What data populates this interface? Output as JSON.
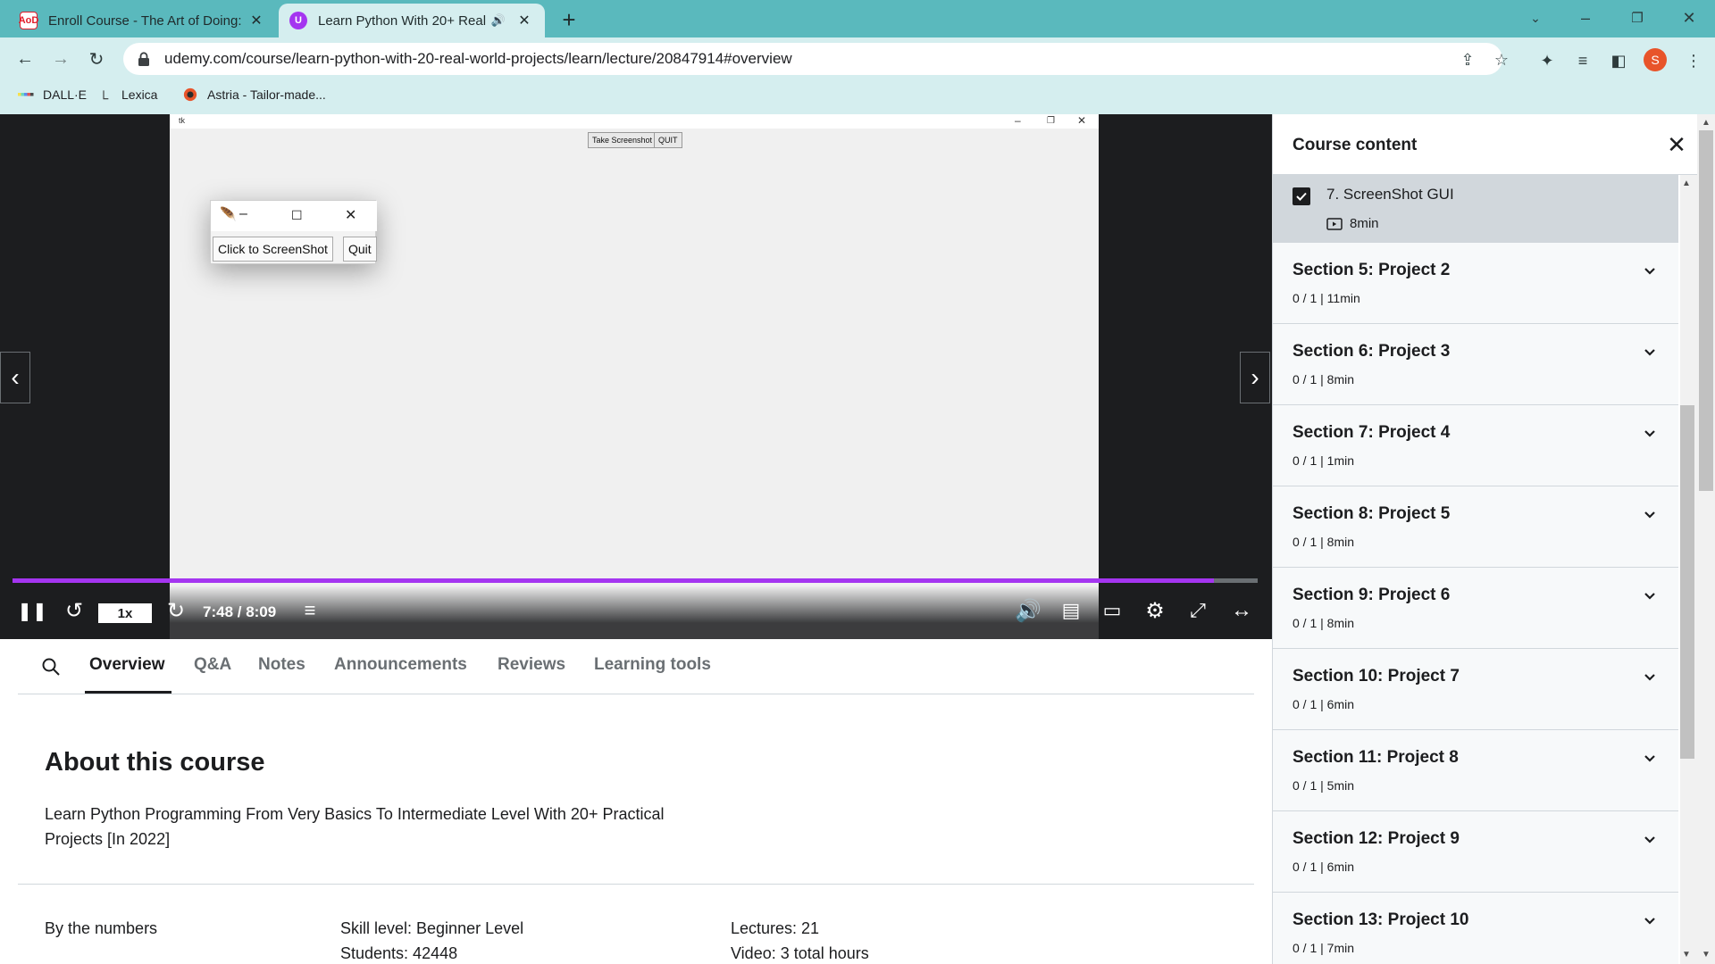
{
  "browser": {
    "tabs": [
      {
        "title": "Enroll Course - The Art of Doing:",
        "favicon": "AoD",
        "favicon_color": "#e11d2a",
        "active": false
      },
      {
        "title": "Learn Python With 20+ Real",
        "favicon": "U",
        "favicon_color": "#a435f0",
        "active": true
      }
    ],
    "url": "udemy.com/course/learn-python-with-20-real-world-projects/learn/lecture/20847914#overview",
    "profile_initial": "S",
    "bookmarks": [
      {
        "label": "DALL·E",
        "icon": "dalle-icon"
      },
      {
        "label": "Lexica",
        "icon": "lexica-icon"
      },
      {
        "label": "Astria - Tailor-made...",
        "icon": "astria-icon"
      }
    ]
  },
  "video": {
    "recording": {
      "window_title": "tk",
      "take_screenshot": "Take Screenshot",
      "quit": "QUIT",
      "popup_button": "Click to ScreenShot",
      "popup_quit": "Quit"
    },
    "progress_fraction": 0.965,
    "speed": "1x",
    "time": "7:48 / 8:09",
    "accent": "#a435f0"
  },
  "content_tabs": [
    "Overview",
    "Q&A",
    "Notes",
    "Announcements",
    "Reviews",
    "Learning tools"
  ],
  "about": {
    "heading": "About this course",
    "description": "Learn Python Programming From Very Basics To Intermediate Level With 20+ Practical Projects [In 2022]",
    "by_numbers_label": "By the numbers",
    "skill_level": "Skill level: Beginner Level",
    "students": "Students: 42448",
    "lectures": "Lectures: 21",
    "video": "Video: 3 total hours"
  },
  "sidebar": {
    "title": "Course content",
    "current_lecture": {
      "title": "7. ScreenShot GUI",
      "duration": "8min",
      "completed": true
    },
    "sections": [
      {
        "title": "Section 5: Project 2",
        "meta": "0 / 1 | 11min"
      },
      {
        "title": "Section 6: Project 3",
        "meta": "0 / 1 | 8min"
      },
      {
        "title": "Section 7: Project 4",
        "meta": "0 / 1 | 1min"
      },
      {
        "title": "Section 8: Project 5",
        "meta": "0 / 1 | 8min"
      },
      {
        "title": "Section 9: Project 6",
        "meta": "0 / 1 | 8min"
      },
      {
        "title": "Section 10: Project 7",
        "meta": "0 / 1 | 6min"
      },
      {
        "title": "Section 11: Project 8",
        "meta": "0 / 1 | 5min"
      },
      {
        "title": "Section 12: Project 9",
        "meta": "0 / 1 | 6min"
      },
      {
        "title": "Section 13: Project 10",
        "meta": "0 / 1 | 7min"
      }
    ]
  }
}
